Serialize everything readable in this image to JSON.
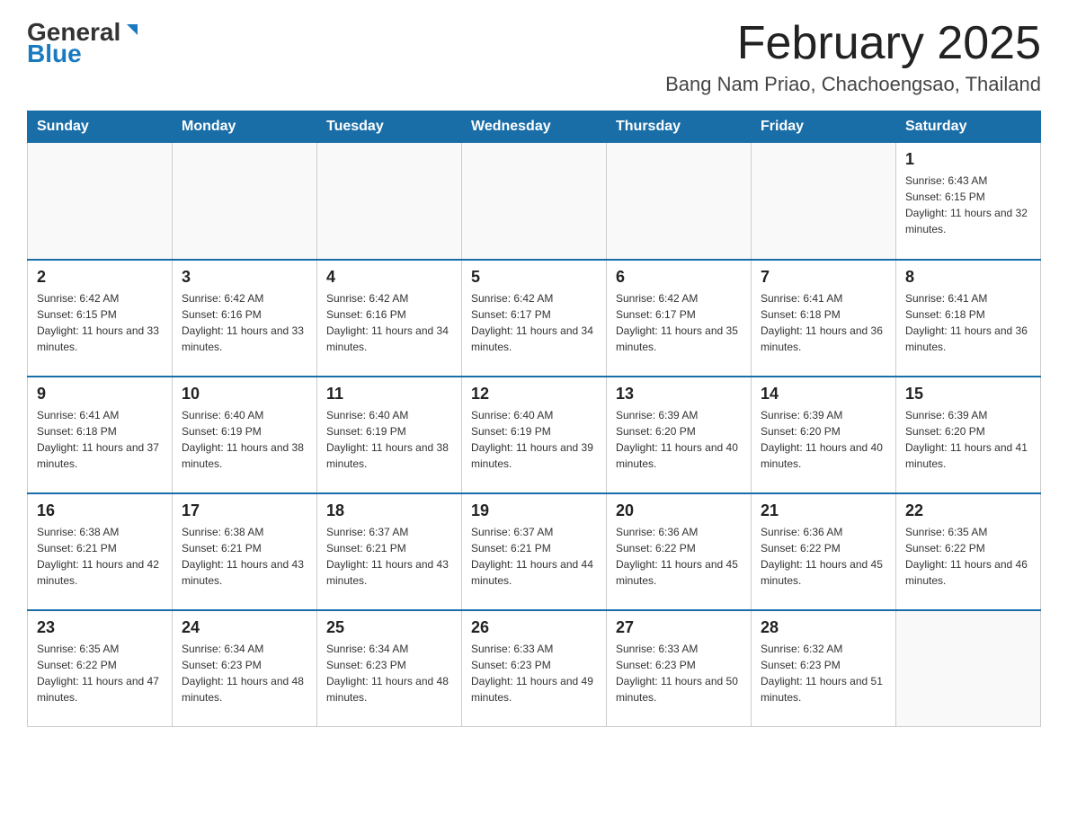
{
  "header": {
    "logo_general": "General",
    "logo_blue": "Blue",
    "title": "February 2025",
    "subtitle": "Bang Nam Priao, Chachoengsao, Thailand"
  },
  "days_of_week": [
    "Sunday",
    "Monday",
    "Tuesday",
    "Wednesday",
    "Thursday",
    "Friday",
    "Saturday"
  ],
  "weeks": [
    {
      "cells": [
        {
          "day": "",
          "info": ""
        },
        {
          "day": "",
          "info": ""
        },
        {
          "day": "",
          "info": ""
        },
        {
          "day": "",
          "info": ""
        },
        {
          "day": "",
          "info": ""
        },
        {
          "day": "",
          "info": ""
        },
        {
          "day": "1",
          "info": "Sunrise: 6:43 AM\nSunset: 6:15 PM\nDaylight: 11 hours and 32 minutes."
        }
      ]
    },
    {
      "cells": [
        {
          "day": "2",
          "info": "Sunrise: 6:42 AM\nSunset: 6:15 PM\nDaylight: 11 hours and 33 minutes."
        },
        {
          "day": "3",
          "info": "Sunrise: 6:42 AM\nSunset: 6:16 PM\nDaylight: 11 hours and 33 minutes."
        },
        {
          "day": "4",
          "info": "Sunrise: 6:42 AM\nSunset: 6:16 PM\nDaylight: 11 hours and 34 minutes."
        },
        {
          "day": "5",
          "info": "Sunrise: 6:42 AM\nSunset: 6:17 PM\nDaylight: 11 hours and 34 minutes."
        },
        {
          "day": "6",
          "info": "Sunrise: 6:42 AM\nSunset: 6:17 PM\nDaylight: 11 hours and 35 minutes."
        },
        {
          "day": "7",
          "info": "Sunrise: 6:41 AM\nSunset: 6:18 PM\nDaylight: 11 hours and 36 minutes."
        },
        {
          "day": "8",
          "info": "Sunrise: 6:41 AM\nSunset: 6:18 PM\nDaylight: 11 hours and 36 minutes."
        }
      ]
    },
    {
      "cells": [
        {
          "day": "9",
          "info": "Sunrise: 6:41 AM\nSunset: 6:18 PM\nDaylight: 11 hours and 37 minutes."
        },
        {
          "day": "10",
          "info": "Sunrise: 6:40 AM\nSunset: 6:19 PM\nDaylight: 11 hours and 38 minutes."
        },
        {
          "day": "11",
          "info": "Sunrise: 6:40 AM\nSunset: 6:19 PM\nDaylight: 11 hours and 38 minutes."
        },
        {
          "day": "12",
          "info": "Sunrise: 6:40 AM\nSunset: 6:19 PM\nDaylight: 11 hours and 39 minutes."
        },
        {
          "day": "13",
          "info": "Sunrise: 6:39 AM\nSunset: 6:20 PM\nDaylight: 11 hours and 40 minutes."
        },
        {
          "day": "14",
          "info": "Sunrise: 6:39 AM\nSunset: 6:20 PM\nDaylight: 11 hours and 40 minutes."
        },
        {
          "day": "15",
          "info": "Sunrise: 6:39 AM\nSunset: 6:20 PM\nDaylight: 11 hours and 41 minutes."
        }
      ]
    },
    {
      "cells": [
        {
          "day": "16",
          "info": "Sunrise: 6:38 AM\nSunset: 6:21 PM\nDaylight: 11 hours and 42 minutes."
        },
        {
          "day": "17",
          "info": "Sunrise: 6:38 AM\nSunset: 6:21 PM\nDaylight: 11 hours and 43 minutes."
        },
        {
          "day": "18",
          "info": "Sunrise: 6:37 AM\nSunset: 6:21 PM\nDaylight: 11 hours and 43 minutes."
        },
        {
          "day": "19",
          "info": "Sunrise: 6:37 AM\nSunset: 6:21 PM\nDaylight: 11 hours and 44 minutes."
        },
        {
          "day": "20",
          "info": "Sunrise: 6:36 AM\nSunset: 6:22 PM\nDaylight: 11 hours and 45 minutes."
        },
        {
          "day": "21",
          "info": "Sunrise: 6:36 AM\nSunset: 6:22 PM\nDaylight: 11 hours and 45 minutes."
        },
        {
          "day": "22",
          "info": "Sunrise: 6:35 AM\nSunset: 6:22 PM\nDaylight: 11 hours and 46 minutes."
        }
      ]
    },
    {
      "cells": [
        {
          "day": "23",
          "info": "Sunrise: 6:35 AM\nSunset: 6:22 PM\nDaylight: 11 hours and 47 minutes."
        },
        {
          "day": "24",
          "info": "Sunrise: 6:34 AM\nSunset: 6:23 PM\nDaylight: 11 hours and 48 minutes."
        },
        {
          "day": "25",
          "info": "Sunrise: 6:34 AM\nSunset: 6:23 PM\nDaylight: 11 hours and 48 minutes."
        },
        {
          "day": "26",
          "info": "Sunrise: 6:33 AM\nSunset: 6:23 PM\nDaylight: 11 hours and 49 minutes."
        },
        {
          "day": "27",
          "info": "Sunrise: 6:33 AM\nSunset: 6:23 PM\nDaylight: 11 hours and 50 minutes."
        },
        {
          "day": "28",
          "info": "Sunrise: 6:32 AM\nSunset: 6:23 PM\nDaylight: 11 hours and 51 minutes."
        },
        {
          "day": "",
          "info": ""
        }
      ]
    }
  ]
}
